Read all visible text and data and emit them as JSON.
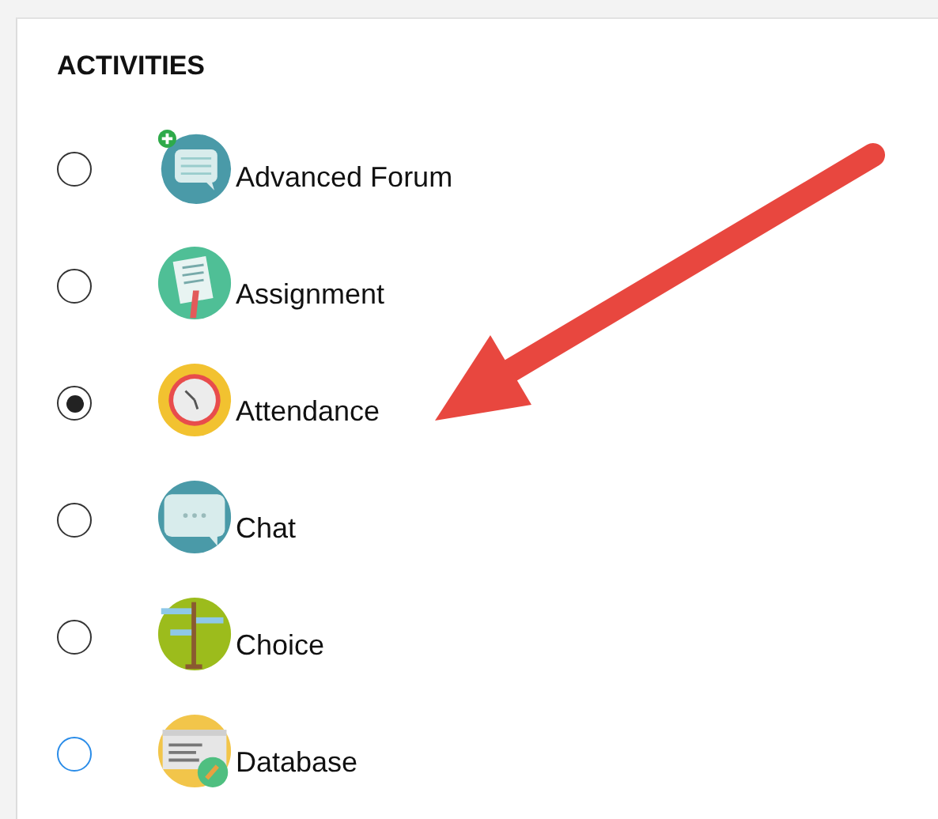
{
  "section": {
    "title": "ACTIVITIES"
  },
  "activities": [
    {
      "label": "Advanced Forum",
      "selected": false,
      "color": "#333333"
    },
    {
      "label": "Assignment",
      "selected": false,
      "color": "#333333"
    },
    {
      "label": "Attendance",
      "selected": true,
      "color": "#333333"
    },
    {
      "label": "Chat",
      "selected": false,
      "color": "#333333"
    },
    {
      "label": "Choice",
      "selected": false,
      "color": "#333333"
    },
    {
      "label": "Database",
      "selected": false,
      "color": "#2a8ce8"
    }
  ]
}
